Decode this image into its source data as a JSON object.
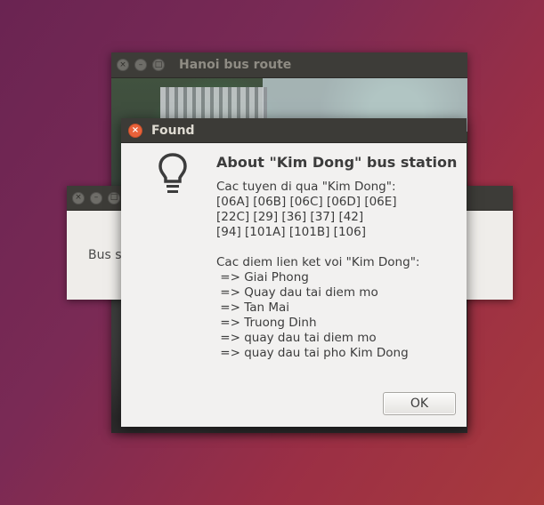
{
  "main_window": {
    "title": "Hanoi bus route",
    "close": "×",
    "minimize": "–",
    "maximize": "□"
  },
  "second_window": {
    "close": "×",
    "minimize": "–",
    "maximize": "□",
    "body_text": "Bus s"
  },
  "dialog": {
    "title": "Found",
    "close": "×",
    "icon": "lightbulb-icon",
    "heading": "About \"Kim Dong\" bus station",
    "routes_label": "Cac tuyen di qua \"Kim Dong\":",
    "routes_lines": [
      "[06A] [06B] [06C] [06D] [06E]",
      "[22C] [29] [36] [37] [42]",
      "[94] [101A] [101B] [106]"
    ],
    "links_label": "Cac diem lien ket voi \"Kim Dong\":",
    "links": [
      " => Giai Phong",
      " => Quay dau tai diem mo",
      " => Tan Mai",
      " => Truong Dinh",
      " => quay dau tai diem mo",
      " => quay dau tai pho Kim Dong"
    ],
    "ok_label": "OK"
  }
}
